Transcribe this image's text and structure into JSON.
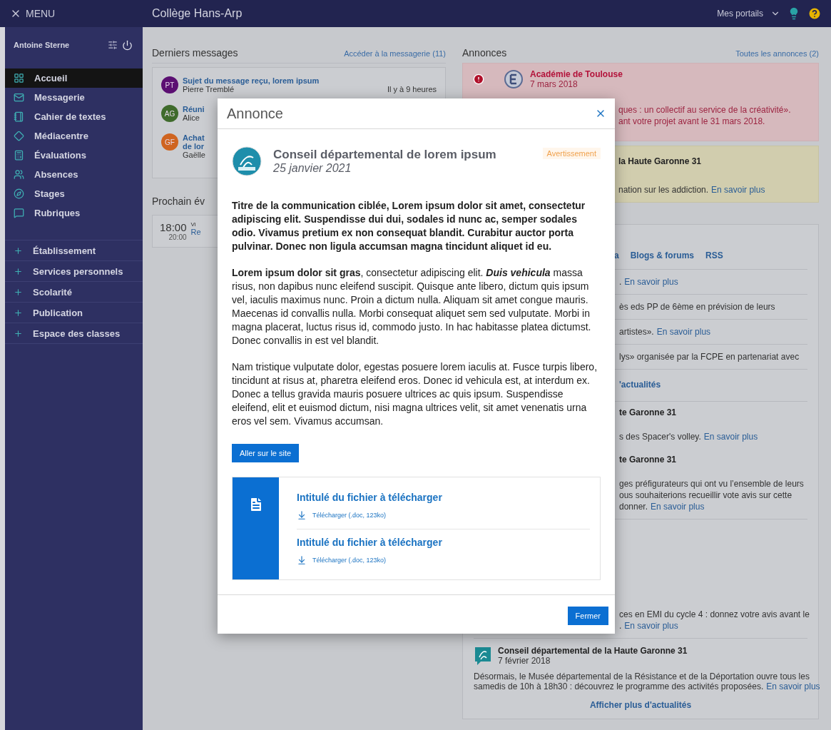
{
  "topbar": {
    "menu": "MENU",
    "title": "Collège Hans-Arp",
    "portals": "Mes portails"
  },
  "sidebar": {
    "user": "Antoine Sterne",
    "nav": [
      {
        "label": "Accueil",
        "selected": true
      },
      {
        "label": "Messagerie",
        "selected": false
      },
      {
        "label": "Cahier de textes",
        "selected": false
      },
      {
        "label": "Médiacentre",
        "selected": false
      },
      {
        "label": "Évaluations",
        "selected": false
      },
      {
        "label": "Absences",
        "selected": false
      },
      {
        "label": "Stages",
        "selected": false
      },
      {
        "label": "Rubriques",
        "selected": false
      }
    ],
    "sections": [
      {
        "label": "Établissement",
        "expanded": false
      },
      {
        "label": "Services personnels",
        "expanded": false
      },
      {
        "label": "Scolarité",
        "expanded": false
      },
      {
        "label": "Publication",
        "expanded": false
      },
      {
        "label": "Espace des classes",
        "expanded": false
      }
    ]
  },
  "messages": {
    "heading": "Derniers messages",
    "link": "Accéder à la messagerie (11)",
    "items": [
      {
        "initials": "PT",
        "color": "#5b0f72",
        "subject_lines": [
          "Sujet du message reçu, lorem ipsum"
        ],
        "sender": "Pierre Tremblé",
        "time": "Il y à 9 heures"
      },
      {
        "initials": "AG",
        "color": "#3f6b2c",
        "subject_lines": [
          "Réuni"
        ],
        "sender": "Alice"
      },
      {
        "initials": "GF",
        "color": "#cf6420",
        "subject_lines": [
          "Achat",
          "de lor"
        ],
        "sender": "Gaëlle"
      }
    ]
  },
  "event": {
    "heading": "Prochain év",
    "start": "18:00",
    "end": "20:00",
    "title": "Vi",
    "link": "Re"
  },
  "announcements": {
    "heading": "Annonces",
    "link": "Toutes les annonces (2)",
    "items": [
      {
        "kind": "alert",
        "source": "Académie de Toulouse",
        "date": "7 mars 2018",
        "lines": [
          "ques : un collectif au service de la créativité».",
          "ant votre projet avant le 31 mars 2018."
        ]
      },
      {
        "kind": "warning",
        "source": "la Haute Garonne 31",
        "lines": [
          "nation sur les addiction."
        ],
        "link": "En savoir plus"
      }
    ]
  },
  "news": {
    "tabs": [
      {
        "label": "a",
        "selected": false
      },
      {
        "label": "Blogs & forums",
        "selected": false
      },
      {
        "label": "RSS",
        "selected": false
      }
    ],
    "items": [
      {
        "kind": "text",
        "lines": [
          "."
        ],
        "link": "En savoir plus"
      },
      {
        "kind": "text",
        "lines": [
          "ès eds PP de 6ème en prévision de leurs"
        ]
      },
      {
        "kind": "text",
        "lines": [
          "artistes»."
        ],
        "link": "En savoir plus"
      },
      {
        "kind": "text",
        "lines": [
          "lys» organisée par la FCPE en partenariat avec"
        ]
      },
      {
        "kind": "heading",
        "text": "'actualités"
      },
      {
        "kind": "source",
        "text": "te Garonne 31"
      },
      {
        "kind": "text",
        "lines": [
          "s des Spacer's volley."
        ],
        "link": "En savoir plus"
      },
      {
        "kind": "source",
        "text": "te Garonne 31"
      },
      {
        "kind": "text",
        "lines": [
          "ges préfigurateurs qui ont vu l’ensemble de leurs",
          "ous souhaiterions recueillir vote avis sur cette",
          "donner."
        ],
        "link": "En savoir plus"
      },
      {
        "kind": "text",
        "lines": [
          "ces en EMI du cycle 4 : donnez votre avis avant le",
          "."
        ],
        "link": "En savoir plus"
      },
      {
        "kind": "entry",
        "source": "Conseil départemental de la Haute Garonne 31",
        "date": "7 février 2018",
        "lines": [
          "Désormais, le Musée départemental de la Résistance et de la Déportation ouvre tous les",
          "samedis de 10h à 18h30 : découvrez le programme des activités proposées."
        ],
        "link": "En savoir plus"
      }
    ],
    "more": "Afficher plus d'actualités"
  },
  "modal": {
    "title": "Annonce",
    "source": "Conseil départemental de lorem ipsum",
    "date": "25 janvier 2021",
    "badge": {
      "text": "Avertissement",
      "kind": "warning"
    },
    "paragraphs": [
      {
        "kind": "lead",
        "text": "Titre de la communication ciblée, Lorem ipsum dolor sit amet, consectetur adipiscing elit. Suspendisse dui dui, sodales id nunc ac, semper sodales odio. Vivamus pretium ex non consequat blandit. Curabitur auctor porta pulvinar. Donec non ligula accumsan magna tincidunt aliquet id eu."
      },
      {
        "kind": "body",
        "text": "**Lorem ipsum dolor sit gras**, consectetur adipiscing elit. *Duis vehicula* massa risus, non dapibus nunc eleifend suscipit. Quisque ante libero, dictum quis ipsum vel, iaculis maximus nunc. Proin a dictum nulla. Aliquam sit amet congue mauris. Maecenas id convallis nulla. Morbi consequat aliquet sem sed vulputate. Morbi in magna placerat, luctus risus id, commodo justo. In hac habitasse platea dictumst. Donec convallis in est vel blandit."
      },
      {
        "kind": "body",
        "text": "Nam tristique vulputate dolor, egestas posuere lorem iaculis at. Fusce turpis libero, tincidunt at risus at, pharetra eleifend eros. Donec id vehicula est, at interdum ex. Donec a tellus gravida mauris posuere ultrices ac quis ipsum. Suspendisse eleifend, elit et euismod dictum, nisi magna ultrices velit, sit amet venenatis urna eros vel sem. Vivamus accumsan."
      }
    ],
    "site_button": "Aller sur le site",
    "files": [
      {
        "title": "Intitulé du fichier à télécharger",
        "download": "Télécharger (.doc, 123ko)"
      },
      {
        "title": "Intitulé du fichier à télécharger",
        "download": "Télécharger (.doc, 123ko)"
      }
    ],
    "close_button": "Fermer"
  }
}
